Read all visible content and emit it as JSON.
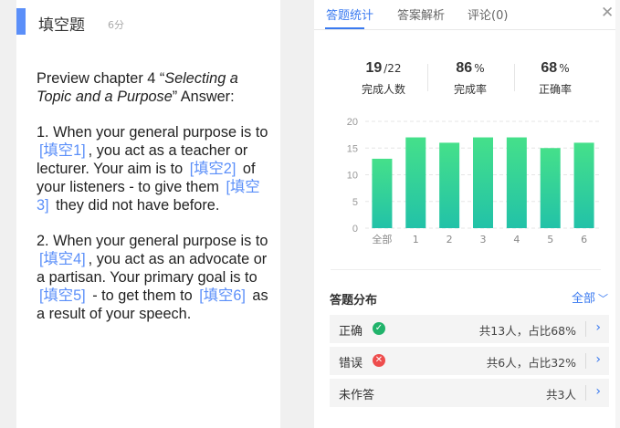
{
  "question": {
    "title": "填空题",
    "score": "6分",
    "intro_prefix": "Preview chapter 4 “",
    "intro_italic": "Selecting a Topic and a Purpose",
    "intro_suffix": "” Answer:",
    "blanks": [
      "[填空1]",
      "[填空2]",
      "[填空3]",
      "[填空4]",
      "[填空5]",
      "[填空6]"
    ],
    "p1": {
      "t1": "1. When your general purpose is to ",
      "t2": ", you act as a teacher or lecturer. Your aim is to ",
      "t3": " of your listeners - to give them ",
      "t4": " they did not have before."
    },
    "p2": {
      "t1": "2. When your general purpose is to ",
      "t2": ", you act as an advocate or a partisan. Your primary goal is to ",
      "t3": " - to get them to ",
      "t4": " as a result of your speech."
    }
  },
  "tabs": {
    "stats": "答题统计",
    "analysis": "答案解析",
    "comments": "评论(0)"
  },
  "stats": {
    "done": {
      "value": "19",
      "unit": "/22",
      "label": "完成人数"
    },
    "completion": {
      "value": "86",
      "unit": "%",
      "label": "完成率"
    },
    "accuracy": {
      "value": "68",
      "unit": "%",
      "label": "正确率"
    }
  },
  "chart_data": {
    "type": "bar",
    "categories": [
      "全部",
      "1",
      "2",
      "3",
      "4",
      "5",
      "6"
    ],
    "values": [
      13,
      17,
      16,
      17,
      17,
      15,
      16
    ],
    "yticks": [
      0,
      5,
      10,
      15,
      20
    ],
    "ylim": [
      0,
      20
    ],
    "grid": true,
    "colors": {
      "top": "#45e08a",
      "bottom": "#22c2a8"
    }
  },
  "distribution": {
    "title": "答题分布",
    "filter": "全部",
    "rows": [
      {
        "label": "正确",
        "text": "共13人，占比68%"
      },
      {
        "label": "错误",
        "text": "共6人，占比32%"
      },
      {
        "label": "未作答",
        "text": "共3人"
      }
    ]
  },
  "colors": {
    "accent": "#3a7af0",
    "correct": "#21b36b",
    "wrong": "#ee4d4d"
  }
}
